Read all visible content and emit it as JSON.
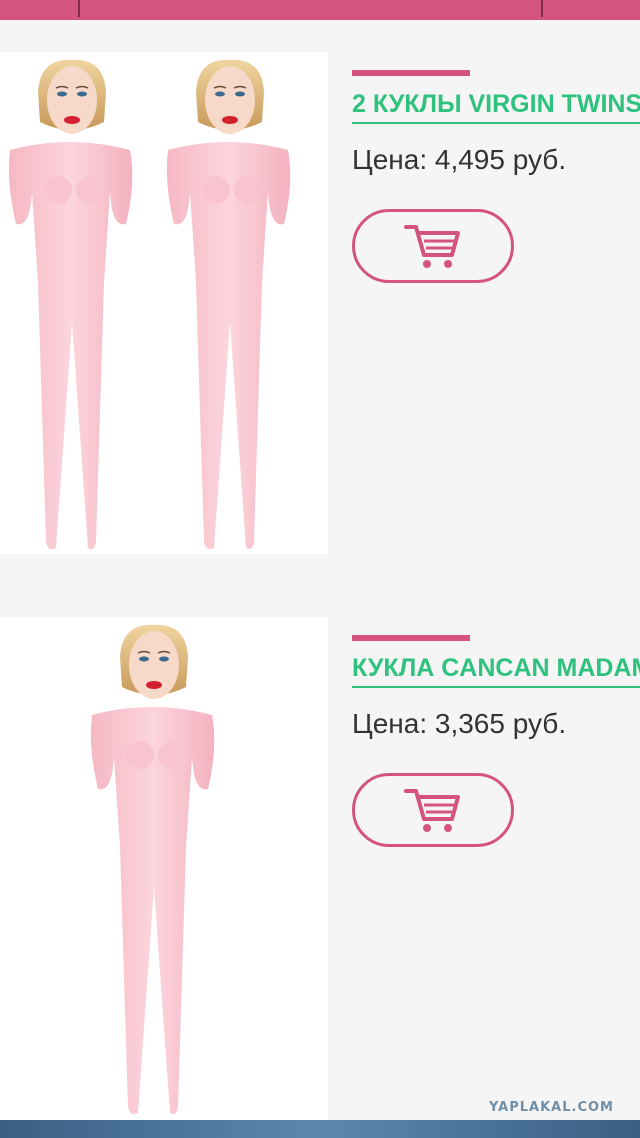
{
  "products": [
    {
      "title": "2 КУКЛЫ VIRGIN TWINS",
      "price": "Цена: 4,495 руб.",
      "cart_icon": "shopping-cart-icon"
    },
    {
      "title": "КУКЛА CANCAN MADAME",
      "price": "Цена: 3,365 руб.",
      "cart_icon": "shopping-cart-icon"
    }
  ],
  "watermark": "YAPLAKAL.COM",
  "colors": {
    "accent": "#d4547e",
    "title_green": "#2ec27e",
    "text": "#333333",
    "background": "#f5f5f5"
  }
}
